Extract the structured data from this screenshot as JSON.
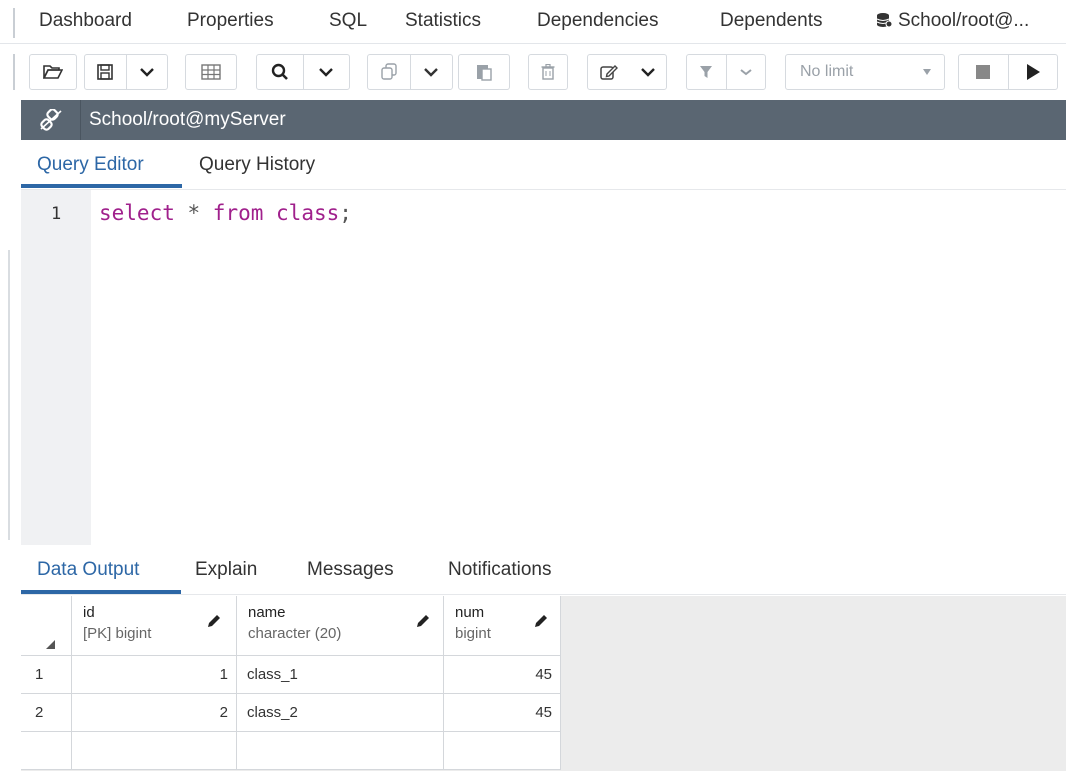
{
  "top_tabs": [
    "Dashboard",
    "Properties",
    "SQL",
    "Statistics",
    "Dependencies",
    "Dependents",
    "School/root@..."
  ],
  "toolbar": {
    "limit_value": "No limit"
  },
  "connection": {
    "label": "School/root@myServer"
  },
  "editor_tabs": [
    "Query Editor",
    "Query History"
  ],
  "editor": {
    "line_number": "1",
    "code_tokens": [
      "select",
      " * ",
      "from",
      " ",
      "class",
      ";"
    ]
  },
  "output_tabs": [
    "Data Output",
    "Explain",
    "Messages",
    "Notifications"
  ],
  "grid": {
    "columns": [
      {
        "name": "id",
        "type": "[PK] bigint"
      },
      {
        "name": "name",
        "type": "character (20)"
      },
      {
        "name": "num",
        "type": "bigint"
      }
    ],
    "rows": [
      {
        "row": "1",
        "id": "1",
        "name": "class_1",
        "num": "45"
      },
      {
        "row": "2",
        "id": "2",
        "name": "class_2",
        "num": "45"
      }
    ]
  },
  "colors": {
    "accent": "#2d67a6",
    "connbar": "#5a6672",
    "keyword": "#a0208c"
  }
}
